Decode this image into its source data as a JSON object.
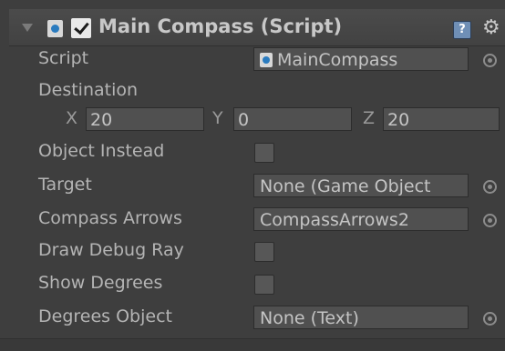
{
  "component": {
    "title": "Main Compass (Script)",
    "enabled": true,
    "icons": {
      "fold": "fold-arrow-icon",
      "script": "script-icon",
      "help": "help-icon",
      "settings": "gear-icon"
    },
    "help_glyph": "?",
    "gear_glyph": "⚙"
  },
  "fields": {
    "script": {
      "label": "Script",
      "value": "MainCompass"
    },
    "destination": {
      "label": "Destination",
      "x_label": "X",
      "x": "20",
      "y_label": "Y",
      "y": "0",
      "z_label": "Z",
      "z": "20"
    },
    "object_instead": {
      "label": "Object Instead",
      "checked": false
    },
    "target": {
      "label": "Target",
      "value": "None (Game Object"
    },
    "compass_arrows": {
      "label": "Compass Arrows",
      "value": "CompassArrows2"
    },
    "draw_debug_ray": {
      "label": "Draw Debug Ray",
      "checked": false
    },
    "show_degrees": {
      "label": "Show Degrees",
      "checked": false
    },
    "degrees_object": {
      "label": "Degrees Object",
      "value": "None (Text)"
    }
  },
  "colors": {
    "background": "#3e3e3e",
    "field": "#505050",
    "text": "#b4b4b4"
  }
}
